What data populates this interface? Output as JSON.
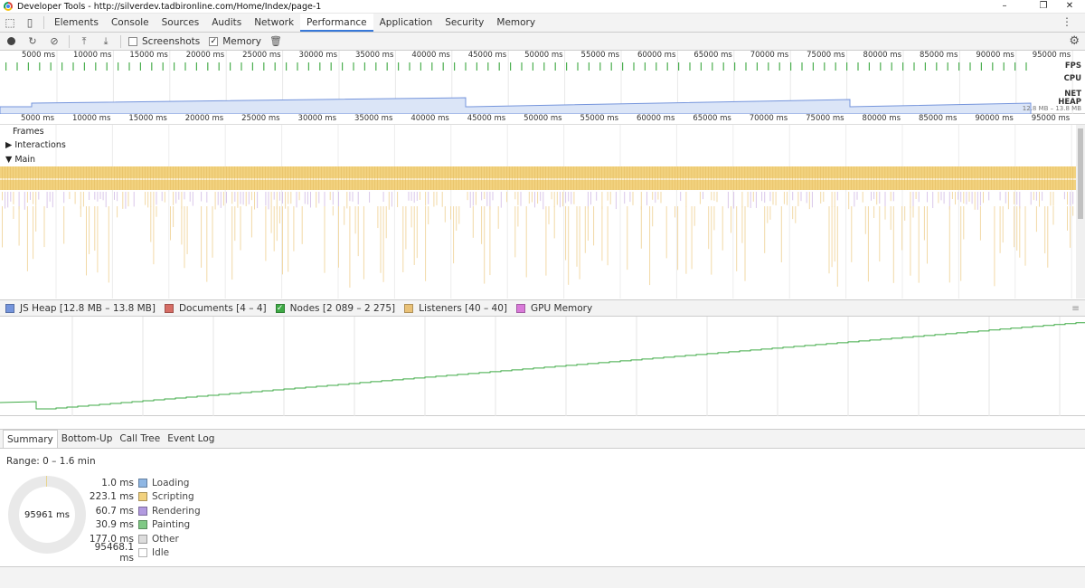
{
  "window": {
    "title": "Developer Tools - http://silverdev.tadbironline.com/Home/Index/page-1",
    "minimize": "–",
    "maximize": "❐",
    "close": "✕"
  },
  "tabs": [
    {
      "label": "Elements",
      "active": false
    },
    {
      "label": "Console",
      "active": false
    },
    {
      "label": "Sources",
      "active": false
    },
    {
      "label": "Audits",
      "active": false
    },
    {
      "label": "Network",
      "active": false
    },
    {
      "label": "Performance",
      "active": true
    },
    {
      "label": "Application",
      "active": false
    },
    {
      "label": "Security",
      "active": false
    },
    {
      "label": "Memory",
      "active": false
    }
  ],
  "toolbar": {
    "screenshots_label": "Screenshots",
    "screenshots_checked": false,
    "memory_label": "Memory",
    "memory_checked": true
  },
  "overview": {
    "ticks": [
      "5000 ms",
      "10000 ms",
      "15000 ms",
      "20000 ms",
      "25000 ms",
      "30000 ms",
      "35000 ms",
      "40000 ms",
      "45000 ms",
      "50000 ms",
      "55000 ms",
      "60000 ms",
      "65000 ms",
      "70000 ms",
      "75000 ms",
      "80000 ms",
      "85000 ms",
      "90000 ms",
      "95000 ms"
    ],
    "fps_label": "FPS",
    "cpu_label": "CPU",
    "net_label": "NET",
    "heap_label": "HEAP",
    "heap_range": "12.8 MB – 13.8 MB"
  },
  "timeline": {
    "ticks": [
      "5000 ms",
      "10000 ms",
      "15000 ms",
      "20000 ms",
      "25000 ms",
      "30000 ms",
      "35000 ms",
      "40000 ms",
      "45000 ms",
      "50000 ms",
      "55000 ms",
      "60000 ms",
      "65000 ms",
      "70000 ms",
      "75000 ms",
      "80000 ms",
      "85000 ms",
      "90000 ms",
      "95000 ms"
    ],
    "frames_label": "Frames",
    "interactions_label": "Interactions",
    "main_label": "Main"
  },
  "memory_legend": [
    {
      "label": "JS Heap [12.8 MB – 13.8 MB]",
      "color": "#7595dc",
      "checked": false
    },
    {
      "label": "Documents [4 – 4]",
      "color": "#d66d65",
      "checked": false
    },
    {
      "label": "Nodes [2 089 – 2 275]",
      "color": "#3eaa45",
      "checked": true
    },
    {
      "label": "Listeners [40 – 40]",
      "color": "#e9c177",
      "checked": false
    },
    {
      "label": "GPU Memory",
      "color": "#d97ad9",
      "checked": false
    }
  ],
  "bottom_tabs": [
    {
      "label": "Summary",
      "active": true
    },
    {
      "label": "Bottom-Up",
      "active": false
    },
    {
      "label": "Call Tree",
      "active": false
    },
    {
      "label": "Event Log",
      "active": false
    }
  ],
  "summary": {
    "range": "Range: 0 – 1.6 min",
    "total": "95961 ms",
    "rows": [
      {
        "value": "1.0 ms",
        "name": "Loading",
        "color": "#8fb7e4"
      },
      {
        "value": "223.1 ms",
        "name": "Scripting",
        "color": "#f2d27f"
      },
      {
        "value": "60.7 ms",
        "name": "Rendering",
        "color": "#b29ae0"
      },
      {
        "value": "30.9 ms",
        "name": "Painting",
        "color": "#7fc985"
      },
      {
        "value": "177.0 ms",
        "name": "Other",
        "color": "#dddddd"
      },
      {
        "value": "95468.1 ms",
        "name": "Idle",
        "color": "#ffffff"
      }
    ]
  },
  "colors": {
    "accent": "#3879d9",
    "fps": "#4caf50",
    "heap_fill": "#dbe5f7",
    "heap_line": "#7595dc",
    "scripting": "#f2d27f",
    "nodes_line": "#3eaa45"
  }
}
